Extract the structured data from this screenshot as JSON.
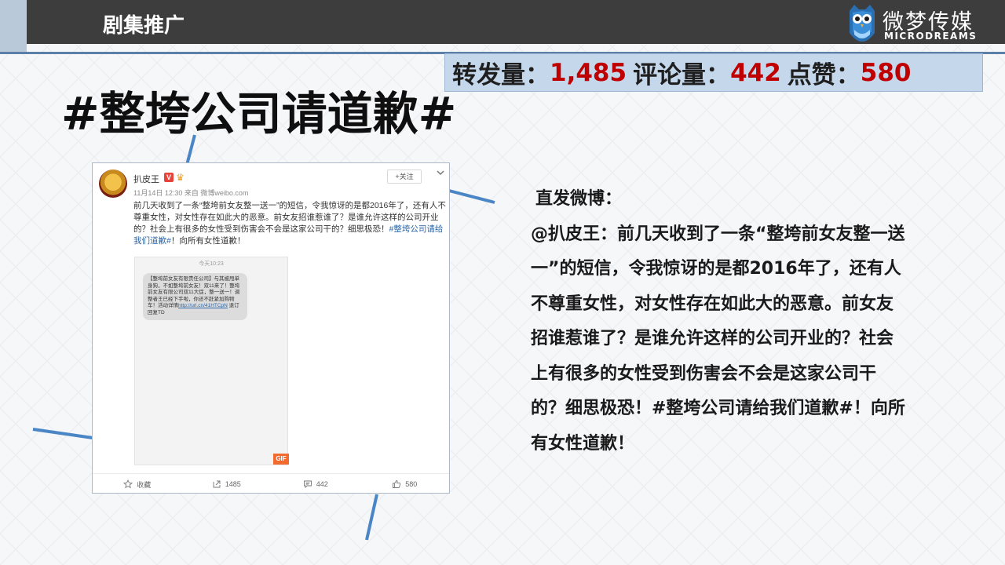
{
  "header": {
    "title": "剧集推广",
    "logo_cn": "微梦传媒",
    "logo_en": "MICRODREAMS"
  },
  "stats": {
    "repost_label": "转发量：",
    "repost_value": "1,485",
    "comment_label": "评论量：",
    "comment_value": "442",
    "like_label": "点赞：",
    "like_value": "580"
  },
  "headline": "#整垮公司请道歉#",
  "card": {
    "user_name": "扒皮王",
    "verified_badge": "V",
    "meta": "11月14日 12:30 来自 微博weibo.com",
    "follow_label": "+关注",
    "text_main": "前几天收到了一条“整垮前女友整一送一”的短信，令我惊讶的是都2016年了，还有人不尊重女性，对女性存在如此大的恶意。前女友招谁惹谁了？是谁允许这样的公司开业的？社会上有很多的女性受到伤害会不会是这家公司干的？细思极恐！",
    "text_tag": "#整垮公司请给我们道歉#",
    "text_tail": "！向所有女性道歉！",
    "sms_time": "今天10:23",
    "sms_text": "【整垮前女友有限责任公司】与其被甩单身狗，不如整垮前女友！双11来了！整垮前女友有限公司双11大促，整一送一！调整者王已经下手啦，你还不赶紧加购物车！活动详情",
    "sms_link": "http://url.cn/41HTCpN",
    "sms_tail": "退订回复TD",
    "gif_label": "GIF",
    "footer": {
      "favorite": "收藏",
      "repost": "1485",
      "comment": "442",
      "like": "580"
    },
    "colors": {
      "link": "#2a66a8",
      "gif": "#f26a2e",
      "verified": "#e8433b"
    }
  },
  "body": {
    "label": "直发微博：",
    "text": "@扒皮王：前几天收到了一条“整垮前女友整一送一”的短信，令我惊讶的是都2016年了，还有人不尊重女性，对女性存在如此大的恶意。前女友招谁惹谁了？是谁允许这样的公司开业的？社会上有很多的女性受到伤害会不会是这家公司干的？细思极恐！#整垮公司请给我们道歉#！向所有女性道歉！"
  },
  "colors": {
    "header_bg": "#3d3d3d",
    "accent_blue": "#5b7fa6",
    "stats_bg": "#c5d7eb",
    "stat_number": "#c00000"
  },
  "icons": [
    "owl-logo-icon",
    "star-icon",
    "share-icon",
    "comment-icon",
    "thumb-up-icon",
    "chevron-down-icon"
  ]
}
